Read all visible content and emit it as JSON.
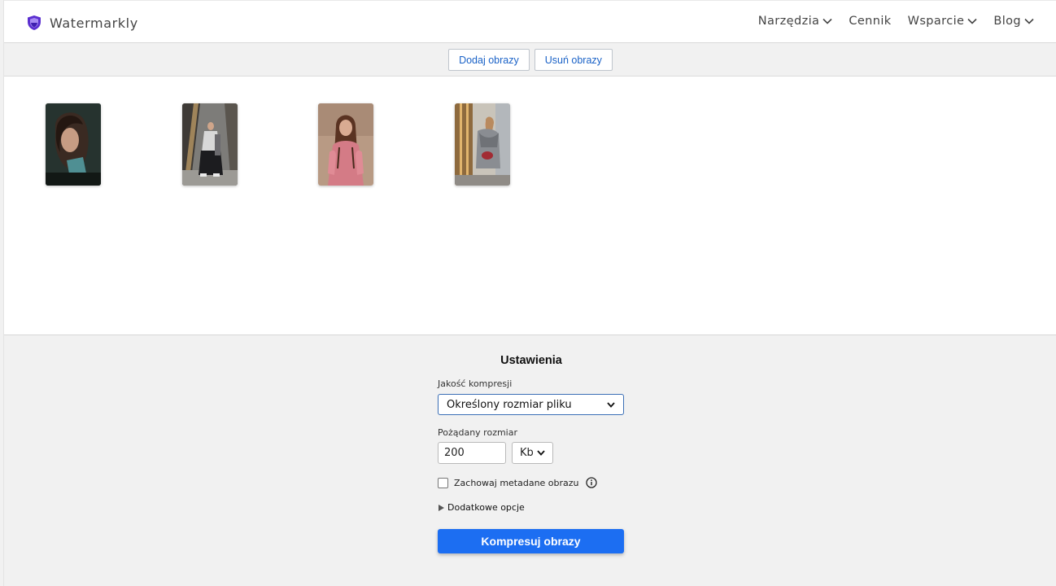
{
  "header": {
    "brand": "Watermarkly",
    "nav": [
      {
        "label": "Narzędzia",
        "dropdown": true
      },
      {
        "label": "Cennik",
        "dropdown": false
      },
      {
        "label": "Wsparcie",
        "dropdown": true
      },
      {
        "label": "Blog",
        "dropdown": true
      }
    ]
  },
  "toolbar": {
    "add_label": "Dodaj obrazy",
    "remove_label": "Usuń obrazy"
  },
  "gallery": {
    "images": [
      "portrait-dark",
      "street-fashion",
      "pink-outfit",
      "grey-scarf"
    ]
  },
  "settings": {
    "title": "Ustawienia",
    "quality_label": "Jakość kompresji",
    "quality_value": "Określony rozmiar pliku",
    "size_label": "Pożądany rozmiar",
    "size_value": "200",
    "unit_value": "Kb",
    "metadata_label": "Zachowaj metadane obrazu",
    "metadata_checked": false,
    "more_options_label": "Dodatkowe opcje",
    "compress_label": "Kompresuj obrazy"
  },
  "colors": {
    "accent": "#1c6ef2",
    "link": "#1a62c7",
    "brand_shield": "#5b2fd0"
  }
}
